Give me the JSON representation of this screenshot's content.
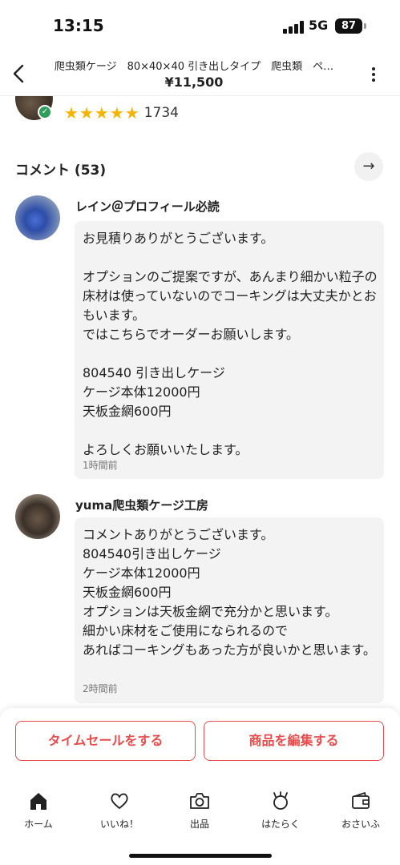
{
  "status_bar": {
    "time": "13:15",
    "network": "5G",
    "battery": "87"
  },
  "header": {
    "title": "爬虫類ケージ　80×40×40 引き出しタイプ　爬虫類　ペ…",
    "price": "¥11,500"
  },
  "seller": {
    "rating_count": "1734",
    "stars": 5
  },
  "comments": {
    "title": "コメント (53)",
    "items": [
      {
        "name": "レイン＠プロフィール必読",
        "text": "お見積りありがとうございます。\n\nオプションのご提案ですが、あんまり細かい粒子の床材は使っていないのでコーキングは大丈夫かとおもいます。\nではこちらでオーダーお願いします。\n\n804540 引き出しケージ\nケージ本体12000円\n天板金網600円\n\nよろしくお願いいたします。",
        "time": "1時間前"
      },
      {
        "name": "yuma爬虫類ケージ工房",
        "text": "コメントありがとうございます。\n804540引き出しケージ\nケージ本体12000円\n天板金網600円\nオプションは天板金網で充分かと思います。\n細かい床材をご使用になられるので\nあればコーキングもあった方が良いかと思います。",
        "time": "2時間前"
      }
    ]
  },
  "actions": {
    "time_sale": "タイムセールをする",
    "edit": "商品を編集する"
  },
  "tabs": [
    {
      "label": "ホーム",
      "icon": "home-icon"
    },
    {
      "label": "いいね！",
      "icon": "heart-icon"
    },
    {
      "label": "出品",
      "icon": "camera-icon"
    },
    {
      "label": "はたらく",
      "icon": "work-icon"
    },
    {
      "label": "おさいふ",
      "icon": "wallet-icon"
    }
  ],
  "colors": {
    "accent": "#e84c4c",
    "star": "#f5b400",
    "verified": "#2e9e5b"
  }
}
